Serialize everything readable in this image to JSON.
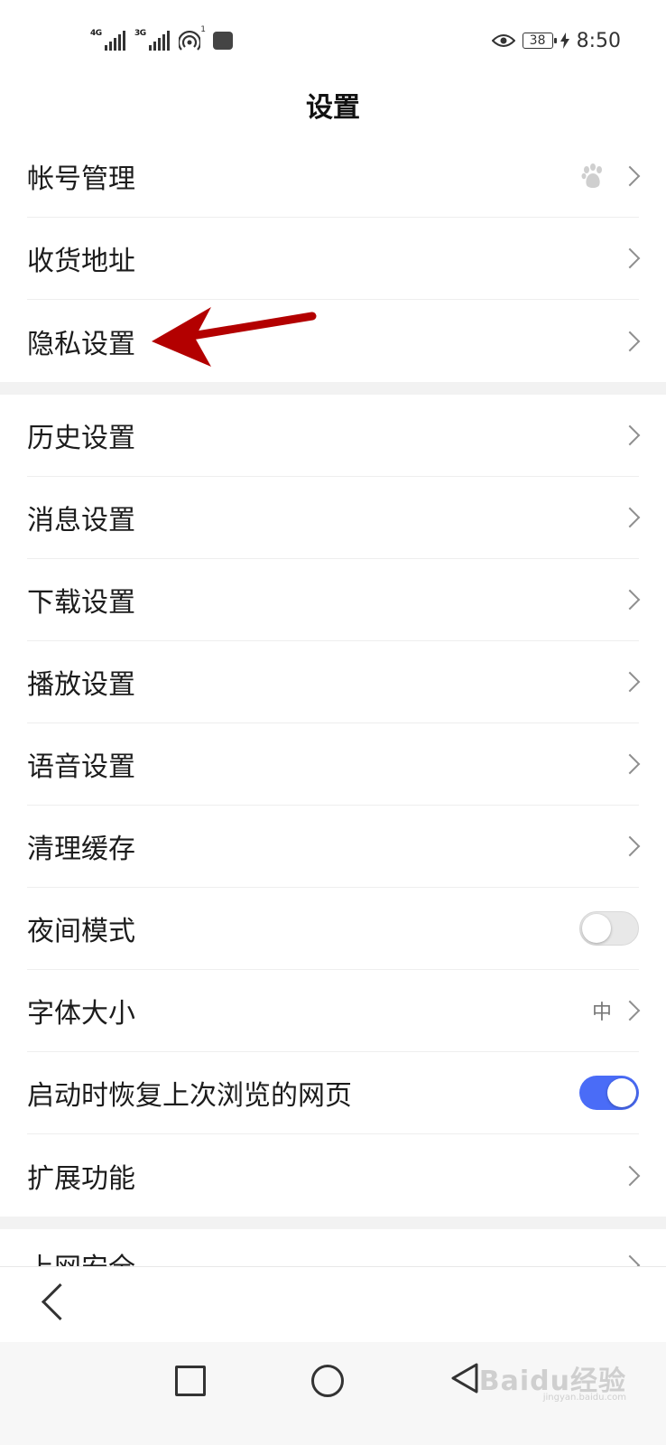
{
  "status_bar": {
    "signal1_label": "4G",
    "signal2_label": "3G",
    "hotspot_count": "1",
    "battery": "38",
    "time": "8:50"
  },
  "header": {
    "title": "设置"
  },
  "group1": [
    {
      "label": "帐号管理"
    },
    {
      "label": "收货地址"
    },
    {
      "label": "隐私设置"
    }
  ],
  "group2": [
    {
      "label": "历史设置"
    },
    {
      "label": "消息设置"
    },
    {
      "label": "下载设置"
    },
    {
      "label": "播放设置"
    },
    {
      "label": "语音设置"
    },
    {
      "label": "清理缓存"
    },
    {
      "label": "夜间模式",
      "toggle": "off"
    },
    {
      "label": "字体大小",
      "value": "中"
    },
    {
      "label": "启动时恢复上次浏览的网页",
      "toggle": "on"
    },
    {
      "label": "扩展功能"
    }
  ],
  "group3": [
    {
      "label": "上网安全"
    }
  ],
  "watermark": {
    "main": "Baidu经验",
    "sub": "jingyan.baidu.com"
  },
  "colors": {
    "toggle_on": "#4a6cf7",
    "annotation_arrow": "#b30000"
  }
}
